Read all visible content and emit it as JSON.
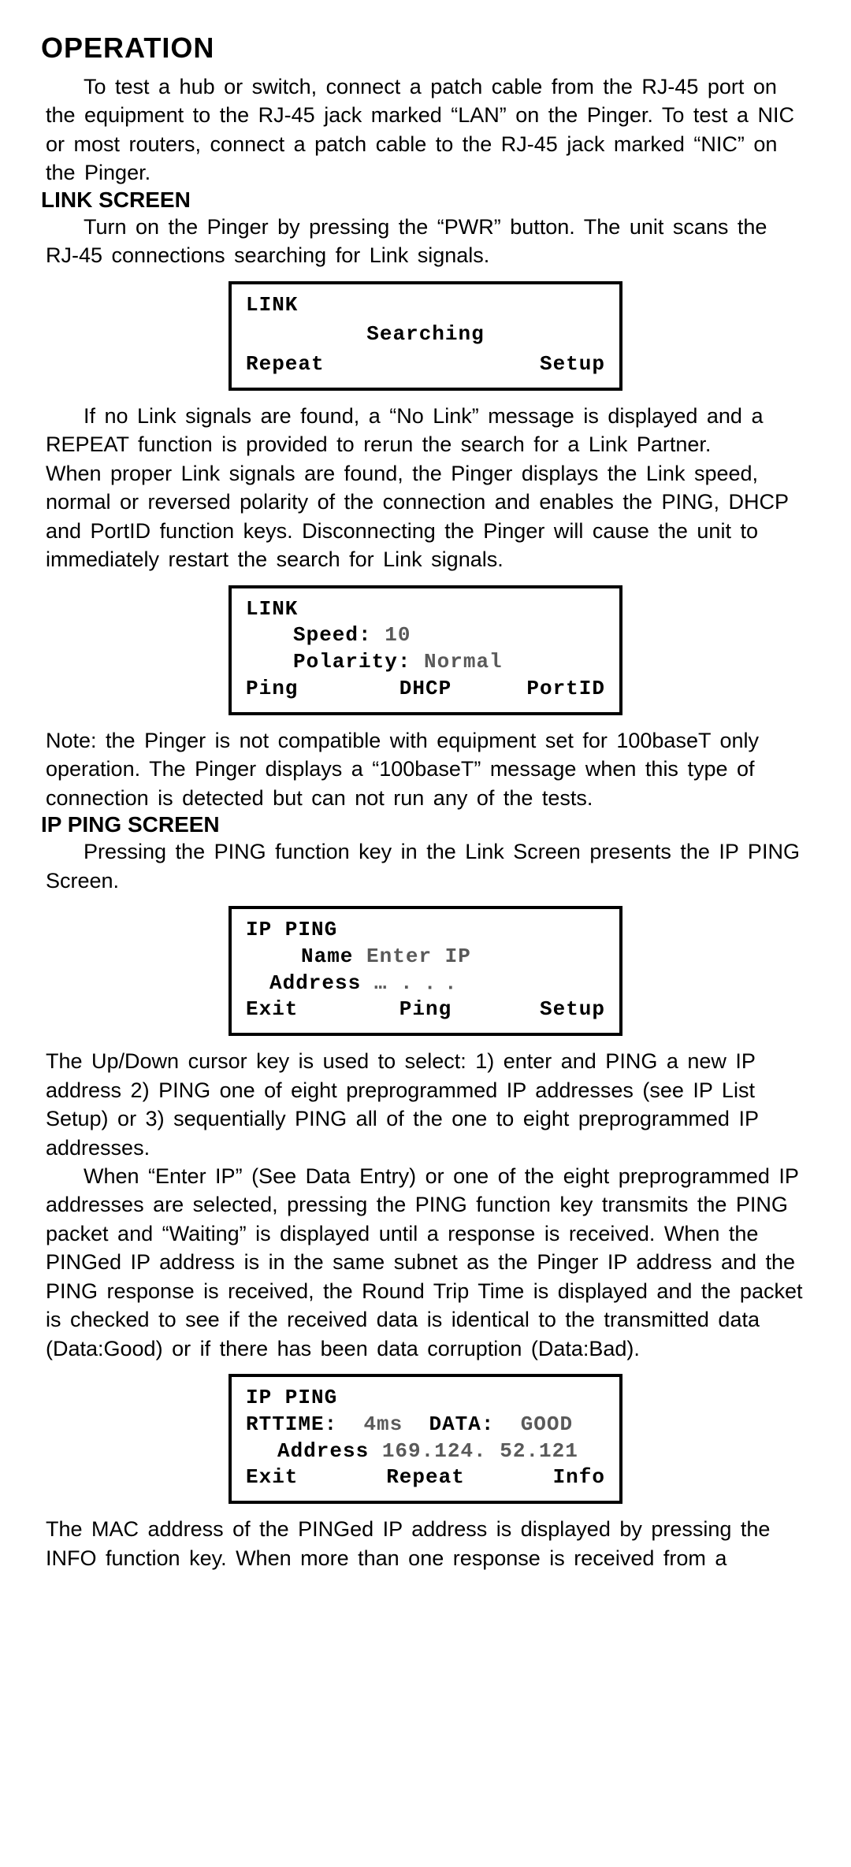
{
  "h1": "OPERATION",
  "p1": "To test a hub or switch, connect a patch cable from the RJ-45 port on the equipment to the RJ-45 jack marked “LAN” on the Pinger. To test a NIC or most routers, connect a patch cable to the RJ-45 jack marked “NIC” on the Pinger.",
  "h2a": "LINK SCREEN",
  "p2": "Turn on the Pinger by pressing the “PWR” button.  The unit scans the RJ-45 connections searching for Link signals.",
  "screen1": {
    "title": "LINK",
    "mid": "Searching",
    "left": "Repeat",
    "right": "Setup"
  },
  "p3a": "If no Link signals are found, a “No Link” message is displayed and a REPEAT function is provided to rerun the search for a Link Partner.",
  "p3b": "When proper Link signals are found, the Pinger displays the Link speed, normal or reversed polarity of the connection and enables the PING, DHCP and PortID function keys. Disconnecting the Pinger will cause the unit to immediately restart the search for Link signals.",
  "screen2": {
    "title": "LINK",
    "row1_label": "Speed:",
    "row1_val": "10",
    "row2_label": "Polarity:",
    "row2_val": "Normal",
    "b1": "Ping",
    "b2": "DHCP",
    "b3": "PortID"
  },
  "p4": "Note: the Pinger is not compatible with equipment set for 100baseT only operation. The Pinger displays a “100baseT” message when this type of connection is detected but can not run any of the tests.",
  "h2b": "IP PING SCREEN",
  "p5": "Pressing the PING function key in the Link Screen presents the IP PING Screen.",
  "screen3": {
    "title": "IP PING",
    "row1_label": "Name",
    "row1_val": "Enter IP",
    "row2_label": "Address",
    "row2_val": "…   .   ․   ․",
    "b1": "Exit",
    "b2": "Ping",
    "b3": "Setup"
  },
  "p6a": "The Up/Down cursor key is used to select: 1) enter and PING a new IP address 2) PING one of eight preprogrammed IP addresses (see IP List Setup) or 3) sequentially PING all of the one to eight preprogrammed IP addresses.",
  "p6b": "When “Enter IP” (See Data Entry) or one of the eight preprogrammed IP addresses are selected, pressing the PING function key transmits the PING packet and “Waiting” is displayed until a response is received. When the PINGed IP address is in the same subnet as the Pinger IP address and the PING response is received, the Round Trip Time is displayed and the packet is checked to see if the received data is identical to the transmitted data (Data:Good) or if there has been data corruption (Data:Bad).",
  "screen4": {
    "title": "IP PING",
    "row1_a": "RTTIME:",
    "row1_av": "4ms",
    "row1_b": "DATA:",
    "row1_bv": "GOOD",
    "row2_label": "Address",
    "row2_val": "169.124. 52.121",
    "b1": "Exit",
    "b2": "Repeat",
    "b3": "Info"
  },
  "p7": "The MAC address of the PINGed IP address is displayed by pressing the INFO function key. When more than one response is received from a"
}
